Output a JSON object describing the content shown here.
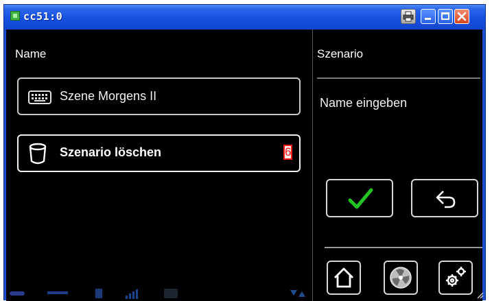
{
  "window": {
    "title": "cc51:0",
    "titlebar_color": "#1450e0",
    "buttons": [
      "print-icon",
      "minimize-icon",
      "maximize-icon",
      "close-icon"
    ]
  },
  "left_panel": {
    "label": "Name",
    "scene_button": {
      "icon": "keyboard-icon",
      "label": "Szene Morgens II"
    },
    "delete_button": {
      "icon": "bucket-icon",
      "label": "Szenario löschen",
      "badge": "6"
    }
  },
  "right_panel": {
    "title": "Szenario",
    "prompt": "Name eingeben",
    "confirm_icon": "checkmark-icon",
    "confirm_color": "#22c322",
    "back_icon": "back-arrow-icon",
    "nav_icons": [
      "home-icon",
      "fan-icon",
      "settings-gears-icon"
    ]
  },
  "colors": {
    "background": "#000000",
    "text": "#ffffff",
    "badge_border": "#ff1a1a"
  }
}
